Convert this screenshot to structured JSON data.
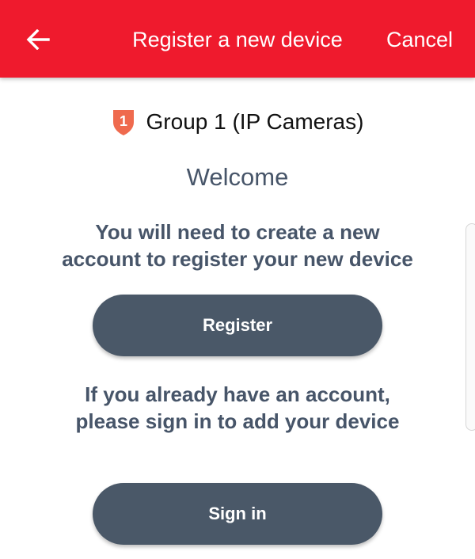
{
  "header": {
    "title": "Register a new device",
    "cancel_label": "Cancel",
    "background_color": "#ef1a2d",
    "back_icon": "arrow-left-icon"
  },
  "group": {
    "badge_number": "1",
    "badge_color": "#ef6a4e",
    "label": "Group 1 (IP Cameras)"
  },
  "welcome": "Welcome",
  "register_section": {
    "instruction_line1": "You will need to create a new",
    "instruction_line2": "account to register your new device",
    "button_label": "Register"
  },
  "signin_section": {
    "instruction_line1": "If you already have an account,",
    "instruction_line2": "please sign in to add your device",
    "button_label": "Sign in"
  },
  "colors": {
    "button": "#4a5868",
    "text_muted": "#475569"
  }
}
